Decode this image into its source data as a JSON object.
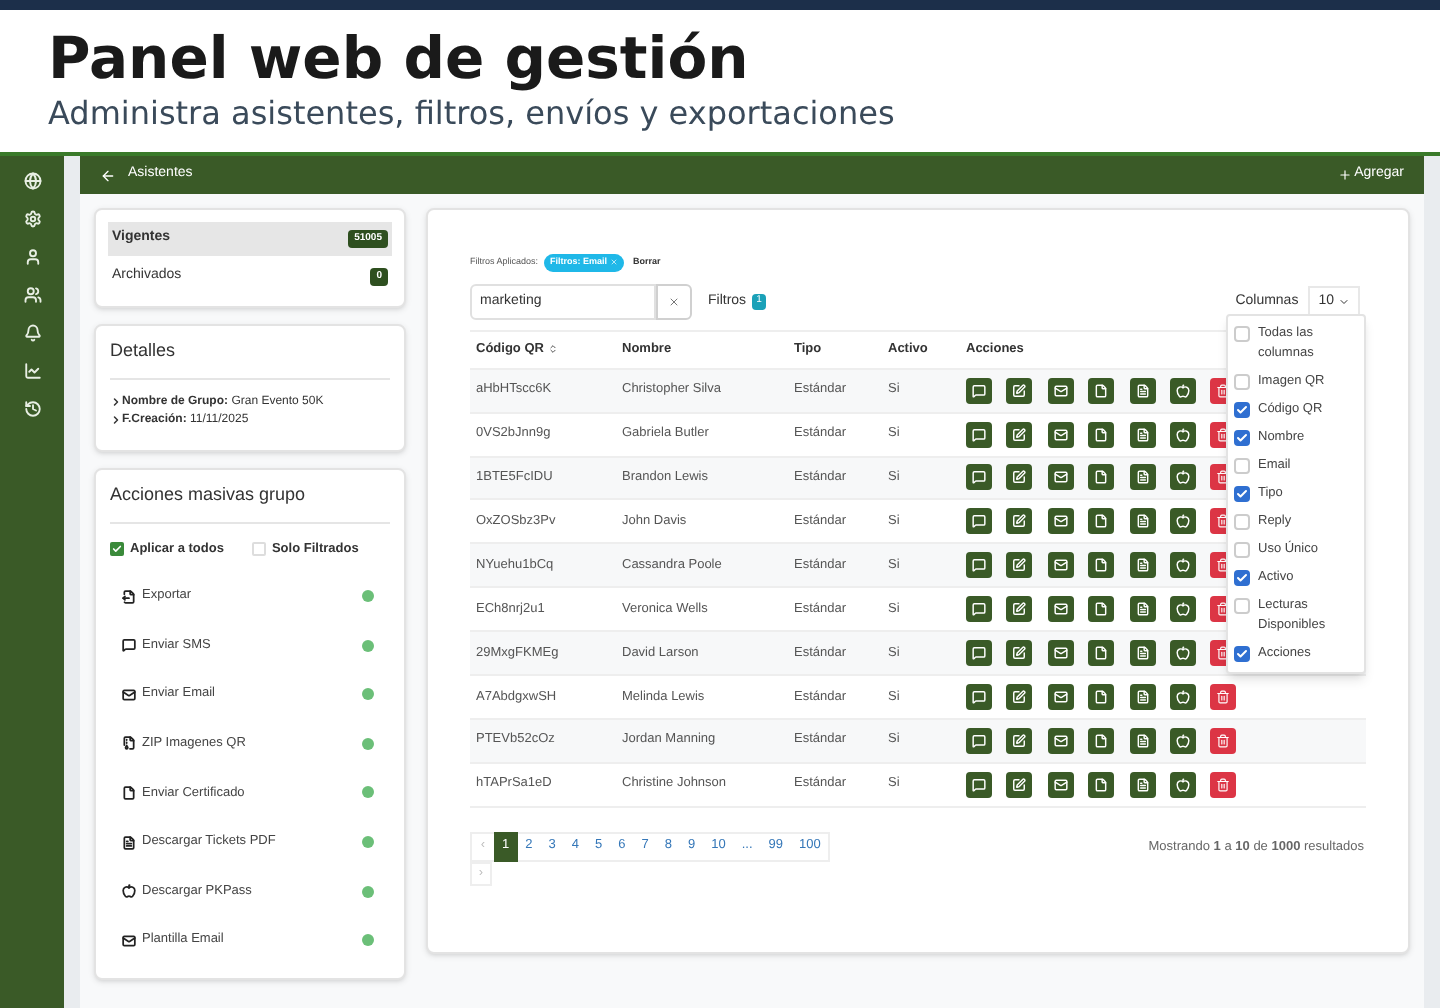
{
  "header": {
    "title": "Panel web de gestión",
    "subtitle": "Administra asistentes, filtros, envíos y exportaciones"
  },
  "page_bar": {
    "title": "Asistentes",
    "add": "Agregar"
  },
  "status_tabs": [
    {
      "label": "Vigentes",
      "count": "51005",
      "selected": true
    },
    {
      "label": "Archivados",
      "count": "0",
      "selected": false
    }
  ],
  "details": {
    "title": "Detalles",
    "items": [
      {
        "label": "Nombre de Grupo:",
        "value": "Gran Evento 50K"
      },
      {
        "label": "F.Creación:",
        "value": "11/11/2025"
      }
    ]
  },
  "mass_actions": {
    "title": "Acciones masivas grupo",
    "scope": [
      {
        "label": "Aplicar a todos",
        "checked": true
      },
      {
        "label": "Solo Filtrados",
        "checked": false
      }
    ],
    "actions": [
      {
        "label": "Exportar",
        "kind": "export"
      },
      {
        "label": "Enviar SMS",
        "kind": "sms"
      },
      {
        "label": "Enviar Email",
        "kind": "email"
      },
      {
        "label": "ZIP Imagenes QR",
        "kind": "zip"
      },
      {
        "label": "Enviar Certificado",
        "kind": "file"
      },
      {
        "label": "Descargar Tickets PDF",
        "kind": "pdf"
      },
      {
        "label": "Descargar PKPass",
        "kind": "apple"
      },
      {
        "label": "Plantilla Email",
        "kind": "email"
      }
    ]
  },
  "filters": {
    "label": "Filtros Aplicados:",
    "chips": [
      {
        "label": "Filtros: Email"
      }
    ],
    "clear": "Borrar",
    "search_value": "marketing",
    "button": "Filtros",
    "count": "1",
    "columns_label": "Columnas",
    "page_size": "10"
  },
  "table": {
    "columns": [
      {
        "label": "Código QR",
        "sortable": true
      },
      {
        "label": "Nombre",
        "sortable": false
      },
      {
        "label": "Tipo",
        "sortable": false
      },
      {
        "label": "Activo",
        "sortable": false
      },
      {
        "label": "Acciones",
        "sortable": false
      }
    ],
    "rows": [
      {
        "code": "aHbHTscc6K",
        "name": "Christopher Silva",
        "type": "Estándar",
        "active": "Si"
      },
      {
        "code": "0VS2bJnn9g",
        "name": "Gabriela Butler",
        "type": "Estándar",
        "active": "Si"
      },
      {
        "code": "1BTE5FcIDU",
        "name": "Brandon Lewis",
        "type": "Estándar",
        "active": "Si"
      },
      {
        "code": "OxZOSbz3Pv",
        "name": "John Davis",
        "type": "Estándar",
        "active": "Si"
      },
      {
        "code": "NYuehu1bCq",
        "name": "Cassandra Poole",
        "type": "Estándar",
        "active": "Si"
      },
      {
        "code": "ECh8nrj2u1",
        "name": "Veronica Wells",
        "type": "Estándar",
        "active": "Si"
      },
      {
        "code": "29MxgFKMEg",
        "name": "David Larson",
        "type": "Estándar",
        "active": "Si"
      },
      {
        "code": "A7AbdgxwSH",
        "name": "Melinda Lewis",
        "type": "Estándar",
        "active": "Si"
      },
      {
        "code": "PTEVb52cOz",
        "name": "Jordan Manning",
        "type": "Estándar",
        "active": "Si"
      },
      {
        "code": "hTAPrSa1eD",
        "name": "Christine Johnson",
        "type": "Estándar",
        "active": "Si"
      }
    ]
  },
  "column_menu": [
    {
      "label": "Todas las columnas",
      "checked": false
    },
    {
      "label": "Imagen QR",
      "checked": false
    },
    {
      "label": "Código QR",
      "checked": true
    },
    {
      "label": "Nombre",
      "checked": true
    },
    {
      "label": "Email",
      "checked": false
    },
    {
      "label": "Tipo",
      "checked": true
    },
    {
      "label": "Reply",
      "checked": false
    },
    {
      "label": "Uso Único",
      "checked": false
    },
    {
      "label": "Activo",
      "checked": true
    },
    {
      "label": "Lecturas Disponibles",
      "checked": false
    },
    {
      "label": "Acciones",
      "checked": true
    }
  ],
  "pagination": {
    "prev": "‹",
    "pages": [
      {
        "label": "1",
        "selected": true
      },
      {
        "label": "2",
        "selected": false
      },
      {
        "label": "3",
        "selected": false
      },
      {
        "label": "4",
        "selected": false
      },
      {
        "label": "5",
        "selected": false
      },
      {
        "label": "6",
        "selected": false
      },
      {
        "label": "7",
        "selected": false
      },
      {
        "label": "8",
        "selected": false
      },
      {
        "label": "9",
        "selected": false
      },
      {
        "label": "10",
        "selected": false
      },
      {
        "label": "...",
        "selected": false
      },
      {
        "label": "99",
        "selected": false
      },
      {
        "label": "100",
        "selected": false
      }
    ],
    "next": "›"
  },
  "summary": "Mostrando **1** a **10** de **1000** resultados"
}
